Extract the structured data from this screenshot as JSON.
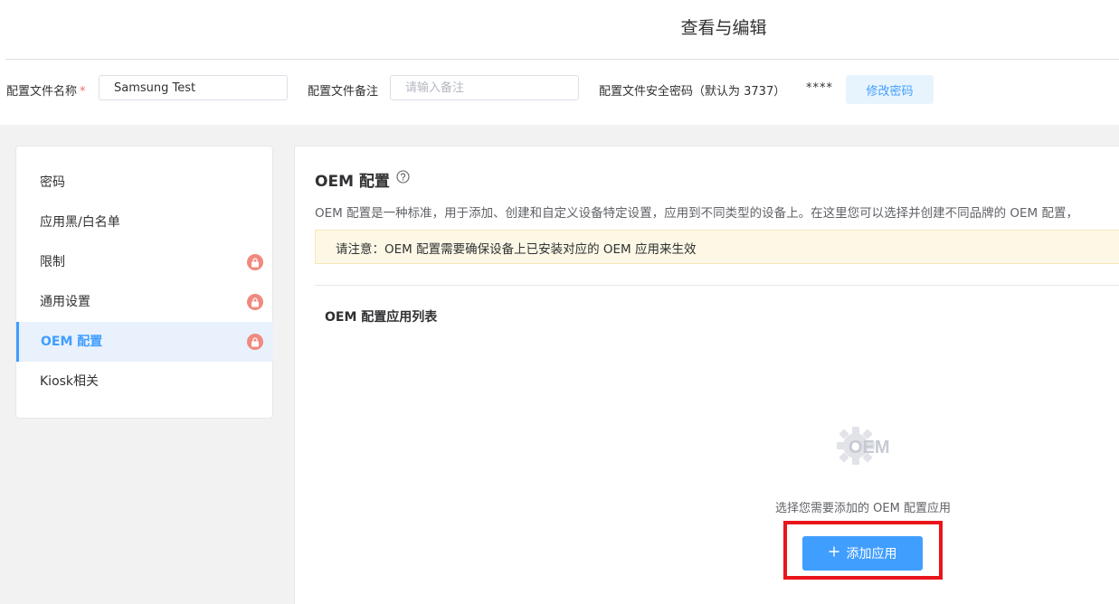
{
  "header": {
    "title": "查看与编辑",
    "profile_name_label": "配置文件名称",
    "required_mark": "*",
    "profile_name_value": "Samsung Test",
    "remark_label": "配置文件备注",
    "remark_placeholder": "请输入备注",
    "password_label": "配置文件安全密码（默认为 3737）",
    "password_mask": "****",
    "change_password_button": "修改密码"
  },
  "sidebar": {
    "items": [
      {
        "label": "密码",
        "locked": false,
        "active": false
      },
      {
        "label": "应用黑/白名单",
        "locked": false,
        "active": false
      },
      {
        "label": "限制",
        "locked": true,
        "active": false
      },
      {
        "label": "通用设置",
        "locked": true,
        "active": false
      },
      {
        "label": "OEM 配置",
        "locked": true,
        "active": true
      },
      {
        "label": "Kiosk相关",
        "locked": false,
        "active": false
      }
    ]
  },
  "main": {
    "section_title": "OEM 配置",
    "description": "OEM 配置是一种标准，用于添加、创建和自定义设备特定设置，应用到不同类型的设备上。在这里您可以选择并创建不同品牌的 OEM 配置，",
    "notice": "请注意：OEM 配置需要确保设备上已安装对应的 OEM 应用来生效",
    "list_title": "OEM 配置应用列表",
    "empty_icon_text": "OEM",
    "empty_text": "选择您需要添加的 OEM 配置应用",
    "add_button": "添加应用"
  },
  "colors": {
    "primary": "#409eff",
    "lock_badge": "#f08a80",
    "highlight_box": "#e8151a",
    "notice_bg": "#fdf8e6"
  },
  "icons": {
    "help": "question-circle-icon",
    "lock": "lock-icon",
    "oem": "gear-icon",
    "plus": "plus-icon"
  }
}
